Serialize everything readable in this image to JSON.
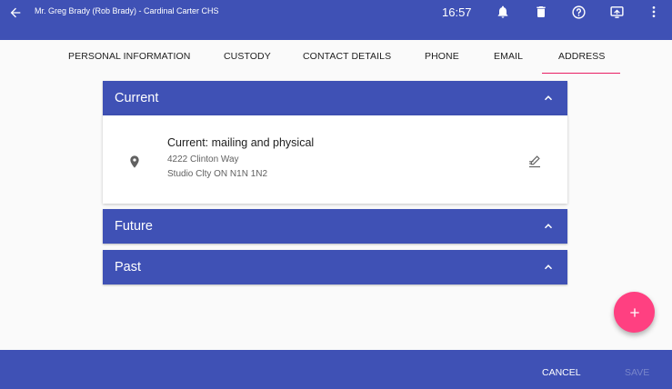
{
  "header": {
    "title": "Mr. Greg Brady (Rob Brady) - Cardinal Carter CHS",
    "time": "16:57",
    "icons": [
      "back-arrow-icon",
      "bell-icon",
      "trash-icon",
      "help-icon",
      "screen-share-icon",
      "more-vert-icon"
    ]
  },
  "tabs": [
    {
      "label": "PERSONAL INFORMATION"
    },
    {
      "label": "CUSTODY"
    },
    {
      "label": "CONTACT DETAILS"
    },
    {
      "label": "PHONE"
    },
    {
      "label": "EMAIL"
    },
    {
      "label": "ADDRESS",
      "active": true
    }
  ],
  "sections": {
    "current": {
      "title": "Current",
      "expanded": true,
      "address": {
        "type_label": "Current: mailing and physical",
        "line1": "4222 Clinton Way",
        "line2": "Studio Clty ON N1N 1N2"
      }
    },
    "future": {
      "title": "Future",
      "expanded": false
    },
    "past": {
      "title": "Past",
      "expanded": false
    }
  },
  "footer": {
    "cancel_label": "CANCEL",
    "save_label": "SAVE",
    "save_disabled": true
  },
  "colors": {
    "primary": "#3f51b5",
    "accent": "#ff4081",
    "tab_indicator": "#e91e63"
  }
}
